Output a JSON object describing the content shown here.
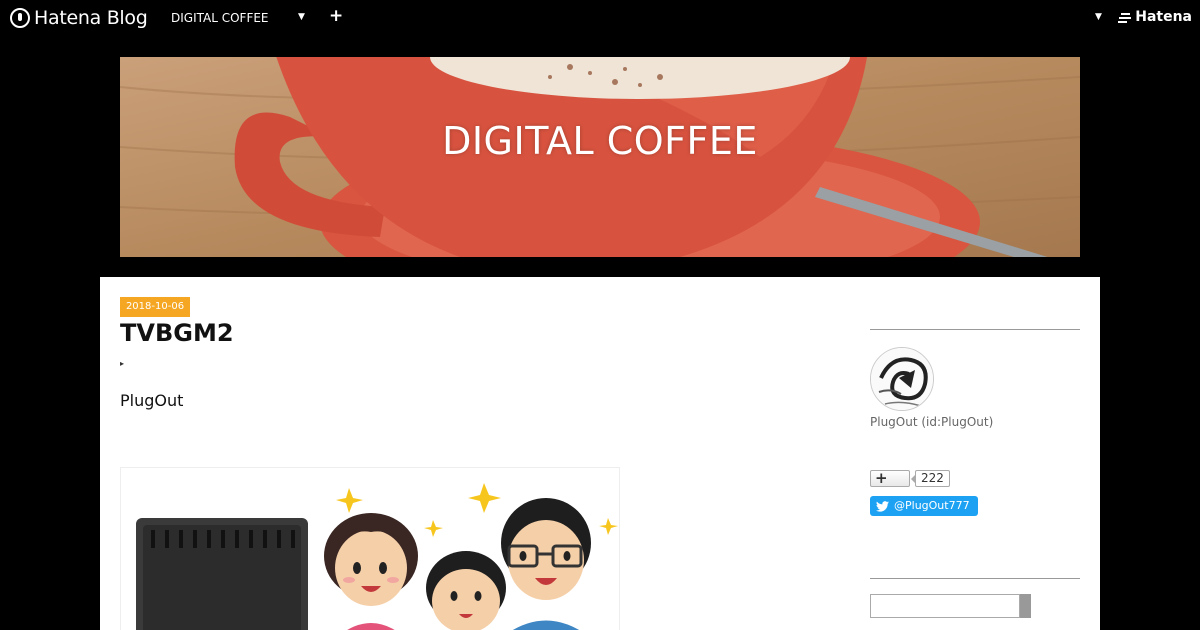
{
  "topbar": {
    "logo_text": "Hatena Blog",
    "blog_name": "DIGITAL COFFEE",
    "add_label": "+",
    "hatena_text": "Hatena"
  },
  "header": {
    "title": "DIGITAL COFFEE"
  },
  "entry": {
    "date": "2018-10-06",
    "title": "TVBGM2",
    "toggle_glyph": "▸",
    "author": "PlugOut"
  },
  "sidebar": {
    "profile_name": "PlugOut (id:PlugOut)",
    "subscribe_glyph": "+",
    "subscribe_count": "222",
    "twitter_handle": "@PlugOut777",
    "search_placeholder": ""
  },
  "colors": {
    "date_badge": "#f5a623",
    "twitter": "#1da1f2",
    "cup": "#d8533f"
  }
}
